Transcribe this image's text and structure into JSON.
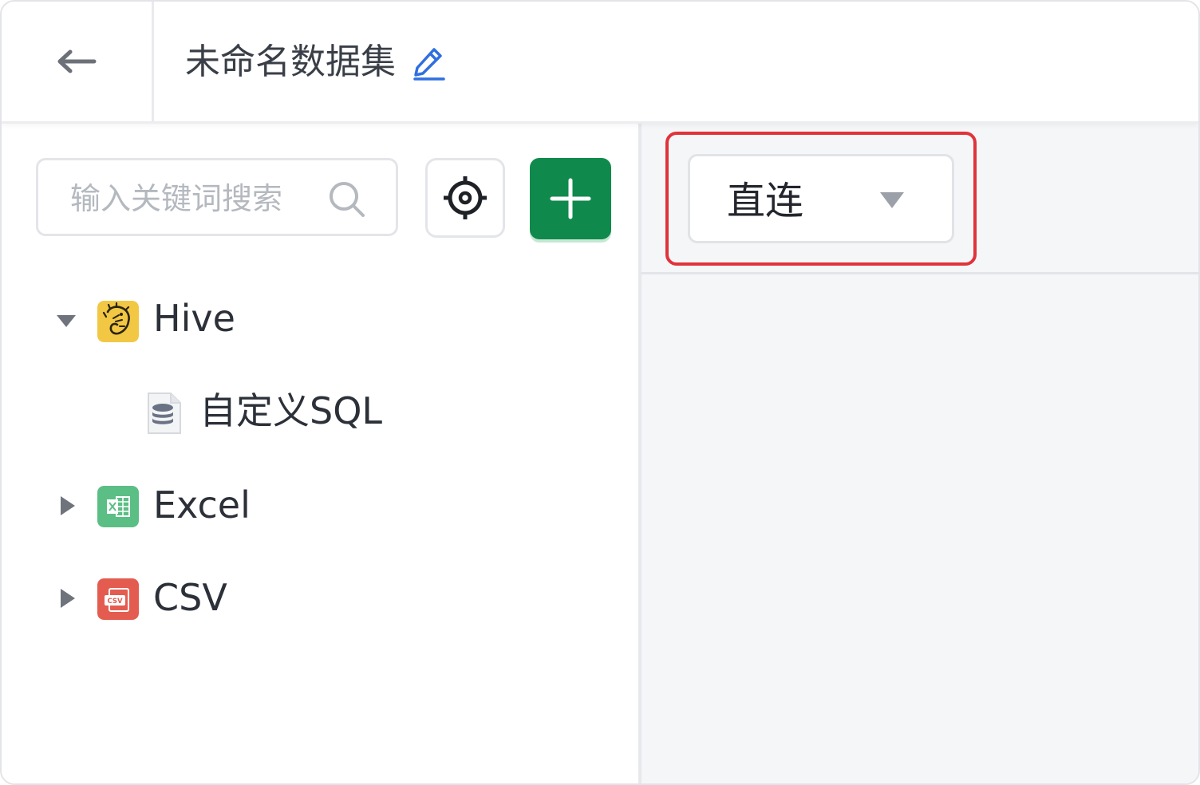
{
  "header": {
    "title": "未命名数据集",
    "back_icon": "arrow-left-icon",
    "edit_icon": "pencil-icon"
  },
  "left_panel": {
    "search": {
      "placeholder": "输入关键词搜索",
      "value": ""
    },
    "locate_icon": "crosshair-icon",
    "add_icon": "plus-icon",
    "tree": [
      {
        "label": "Hive",
        "expanded": true,
        "icon": "hive-icon",
        "children": [
          {
            "label": "自定义SQL",
            "icon": "database-file-icon"
          }
        ]
      },
      {
        "label": "Excel",
        "expanded": false,
        "icon": "excel-icon"
      },
      {
        "label": "CSV",
        "expanded": false,
        "icon": "csv-icon"
      }
    ]
  },
  "right_panel": {
    "mode_select": {
      "value": "直连",
      "icon": "caret-down-icon"
    }
  },
  "colors": {
    "accent_green": "#0f8a4c",
    "highlight_red": "#e0333a",
    "edit_blue": "#2f6fe0",
    "hive_yellow": "#f2c744",
    "excel_green": "#5bbf85",
    "csv_red": "#e45c50"
  }
}
